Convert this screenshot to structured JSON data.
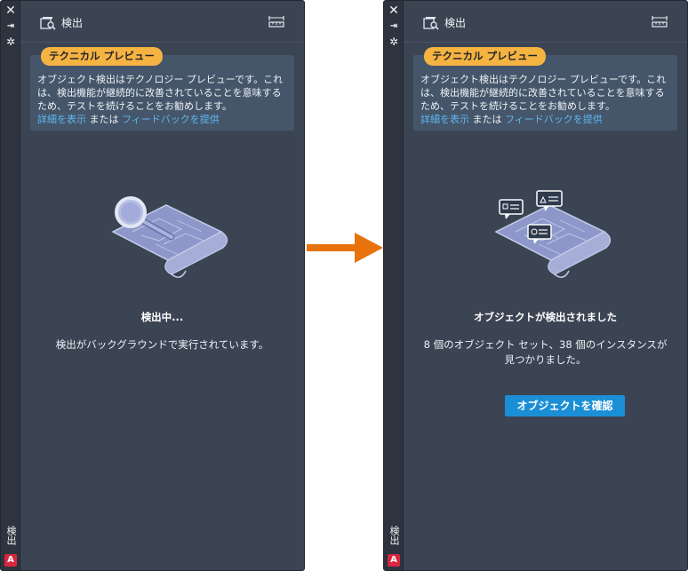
{
  "colors": {
    "panel_bg": "#3b4453",
    "accent_orange": "#f5b342",
    "link_blue": "#5fb7f2",
    "button_blue": "#1b8fd6",
    "arrow": "#e8720c"
  },
  "strip": {
    "close_glyph": "✕",
    "pin_glyph": "⇥",
    "settings_glyph": "✲",
    "vertical_label": "検出",
    "logo_letter": "A"
  },
  "header": {
    "title": "検出",
    "icon": "detect-icon",
    "right_icon": "ruler-icon"
  },
  "preview": {
    "badge": "テクニカル プレビュー",
    "text": "オブジェクト検出はテクノロジー プレビューです。これは、検出機能が継続的に改善されていることを意味するため、テストを続けることをお勧めします。",
    "details_link": "詳細を表示",
    "or": " または ",
    "feedback_link": "フィードバックを提供"
  },
  "left": {
    "status_title": "検出中...",
    "status_desc": "検出がバックグラウンドで実行されています。"
  },
  "right": {
    "status_title": "オブジェクトが検出されました",
    "status_desc": "8 個のオブジェクト セット、38 個のインスタンスが見つかりました。",
    "button_label": "オブジェクトを確認"
  }
}
